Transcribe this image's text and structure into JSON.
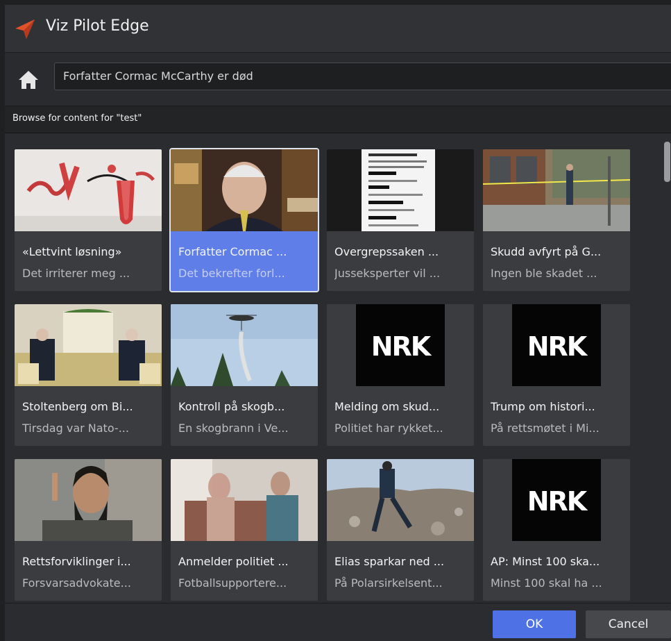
{
  "app": {
    "title": "Viz Pilot Edge"
  },
  "addressbar": {
    "value": "Forfatter Cormac McCarthy er død",
    "home_icon": "home-icon"
  },
  "browse": {
    "label": "Browse for content for \"test\""
  },
  "cards": [
    {
      "title": "«Lettvint løsning»",
      "subtitle": "Det irriterer meg ...",
      "thumb": "art-installation"
    },
    {
      "title": "Forfatter Cormac ...",
      "subtitle": "Det bekrefter forl...",
      "thumb": "portrait",
      "selected": true
    },
    {
      "title": "Overgrepssaken ...",
      "subtitle": "Jusseksperter vil ...",
      "thumb": "document"
    },
    {
      "title": "Skudd avfyrt på G...",
      "subtitle": "Ingen ble skadet ...",
      "thumb": "street"
    },
    {
      "title": "Stoltenberg om Bi...",
      "subtitle": "Tirsdag var Nato-...",
      "thumb": "meeting"
    },
    {
      "title": "Kontroll på skogb...",
      "subtitle": "En skogbrann i Ve...",
      "thumb": "helicopter"
    },
    {
      "title": "Melding om skud...",
      "subtitle": "Politiet har rykket...",
      "thumb": "nrk"
    },
    {
      "title": "Trump om histori...",
      "subtitle": "På rettsmøtet i Mi...",
      "thumb": "nrk"
    },
    {
      "title": "Rettsforviklinger i...",
      "subtitle": "Forsvarsadvokate...",
      "thumb": "bearded-man"
    },
    {
      "title": "Anmelder politiet ...",
      "subtitle": "Fotballsupportere...",
      "thumb": "two-men"
    },
    {
      "title": "Elias sparkar ned ...",
      "subtitle": "På Polarsirkelsent...",
      "thumb": "landscape"
    },
    {
      "title": "AP: Minst 100 ska...",
      "subtitle": "Minst 100 skal ha ...",
      "thumb": "nrk"
    }
  ],
  "nrk_logo": "NRK",
  "buttons": {
    "ok": "OK",
    "cancel": "Cancel"
  }
}
